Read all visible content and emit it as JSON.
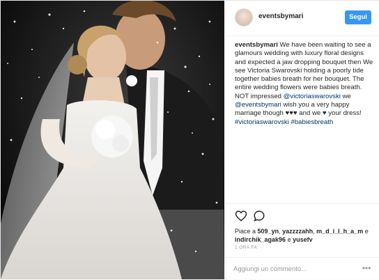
{
  "post": {
    "username": "eventsbymari",
    "follow_label": "Segui",
    "caption": {
      "author": "eventsbymari",
      "text_1": "We have been waiting to see a glamours wedding with luxury floral designs and expected a jaw dropping bouquet then We see Victoria Swarovski holding a poorly tide together babies breath for her bouquet. The entire wedding flowers were babies breath. NOT impressed",
      "mention_1": "@victoriaswarovski",
      "text_2": "we",
      "mention_2": "@eventsbymari",
      "text_3": "wish you a very happy marriage though ♥♥♥ and we ♥ your dress!",
      "hashtag_1": "#victoriaswarovski",
      "hashtag_2": "#babiesbreath"
    },
    "icons": {
      "like": "heart-icon",
      "comment": "comment-icon"
    },
    "likes": {
      "prefix": "Piace a",
      "users": [
        "509_yn",
        "yazzzzahh",
        "m_d_i_l_h_a_m",
        "indirchik_agak96"
      ],
      "sep": ",",
      "and_word": "e",
      "last_user": "yusefv"
    },
    "time_ago": "1 ORA FA",
    "comment_placeholder": "Aggiungi un commento...",
    "more_label": "•••"
  }
}
